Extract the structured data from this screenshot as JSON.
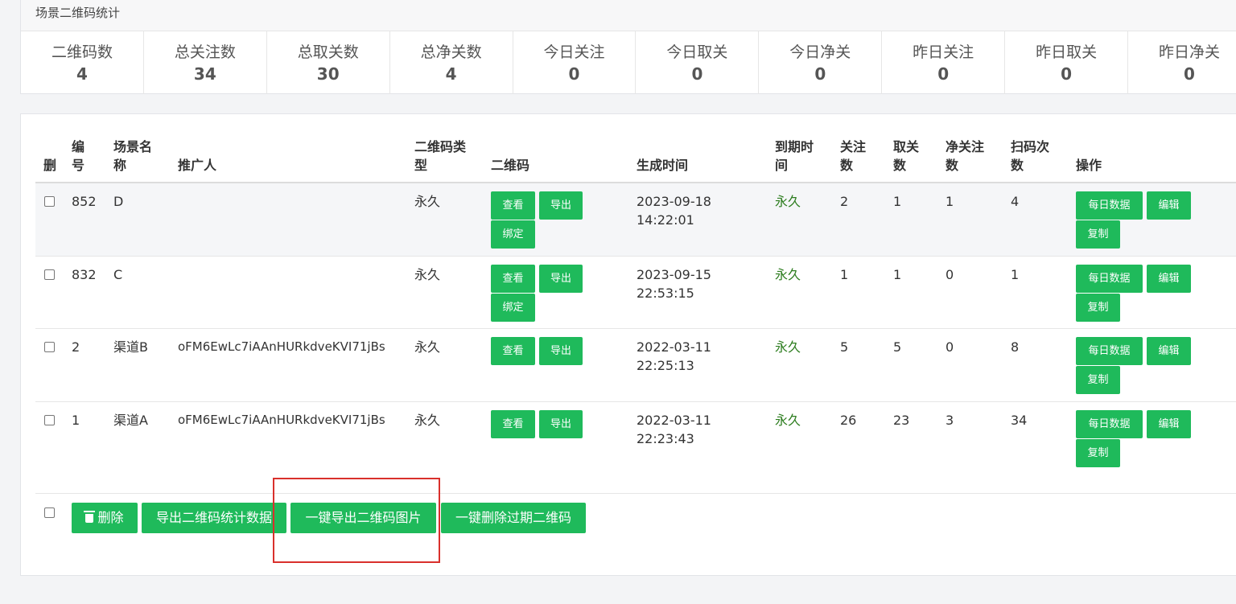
{
  "stats": {
    "title": "场景二维码统计",
    "items": [
      {
        "label": "二维码数",
        "value": "4"
      },
      {
        "label": "总关注数",
        "value": "34"
      },
      {
        "label": "总取关数",
        "value": "30"
      },
      {
        "label": "总净关数",
        "value": "4"
      },
      {
        "label": "今日关注",
        "value": "0"
      },
      {
        "label": "今日取关",
        "value": "0"
      },
      {
        "label": "今日净关",
        "value": "0"
      },
      {
        "label": "昨日关注",
        "value": "0"
      },
      {
        "label": "昨日取关",
        "value": "0"
      },
      {
        "label": "昨日净关",
        "value": "0"
      }
    ]
  },
  "table": {
    "headers": {
      "del": "删",
      "id": "编\n号",
      "scene": "场景名\n称",
      "promoter": "推广人",
      "qr_type": "二维码类\n型",
      "qr": "二维码",
      "created": "生成时间",
      "expire": "到期时\n间",
      "follow": "关注\n数",
      "unfollow": "取关\n数",
      "net": "净关注\n数",
      "scans": "扫码次\n数",
      "ops": "操作"
    },
    "buttons": {
      "view": "查看",
      "export": "导出",
      "bind": "绑定",
      "daily": "每日数据",
      "edit": "编辑",
      "copy": "复制"
    },
    "rows": [
      {
        "id": "852",
        "scene": "D",
        "promoter": "",
        "qr_type": "永久",
        "date": "2023-09-18",
        "time": "14:22:01",
        "expire": "永久",
        "follow": "2",
        "unfollow": "1",
        "net": "1",
        "scans": "4"
      },
      {
        "id": "832",
        "scene": "C",
        "promoter": "",
        "qr_type": "永久",
        "date": "2023-09-15",
        "time": "22:53:15",
        "expire": "永久",
        "follow": "1",
        "unfollow": "1",
        "net": "0",
        "scans": "1"
      },
      {
        "id": "2",
        "scene": "渠道B",
        "promoter": "oFM6EwLc7iAAnHURkdveKVI71jBs",
        "qr_type": "永久",
        "date": "2022-03-11",
        "time": "22:25:13",
        "expire": "永久",
        "follow": "5",
        "unfollow": "5",
        "net": "0",
        "scans": "8"
      },
      {
        "id": "1",
        "scene": "渠道A",
        "promoter": "oFM6EwLc7iAAnHURkdveKVI71jBs",
        "qr_type": "永久",
        "date": "2022-03-11",
        "time": "22:23:43",
        "expire": "永久",
        "follow": "26",
        "unfollow": "23",
        "net": "3",
        "scans": "34"
      }
    ]
  },
  "footer": {
    "delete": "删除",
    "export_stats": "导出二维码统计数据",
    "export_images": "一键导出二维码图片",
    "delete_expired": "一键删除过期二维码"
  },
  "colors": {
    "accent": "#1fba5b",
    "highlight": "#d9302c",
    "expire_text": "#2d7d1f"
  }
}
